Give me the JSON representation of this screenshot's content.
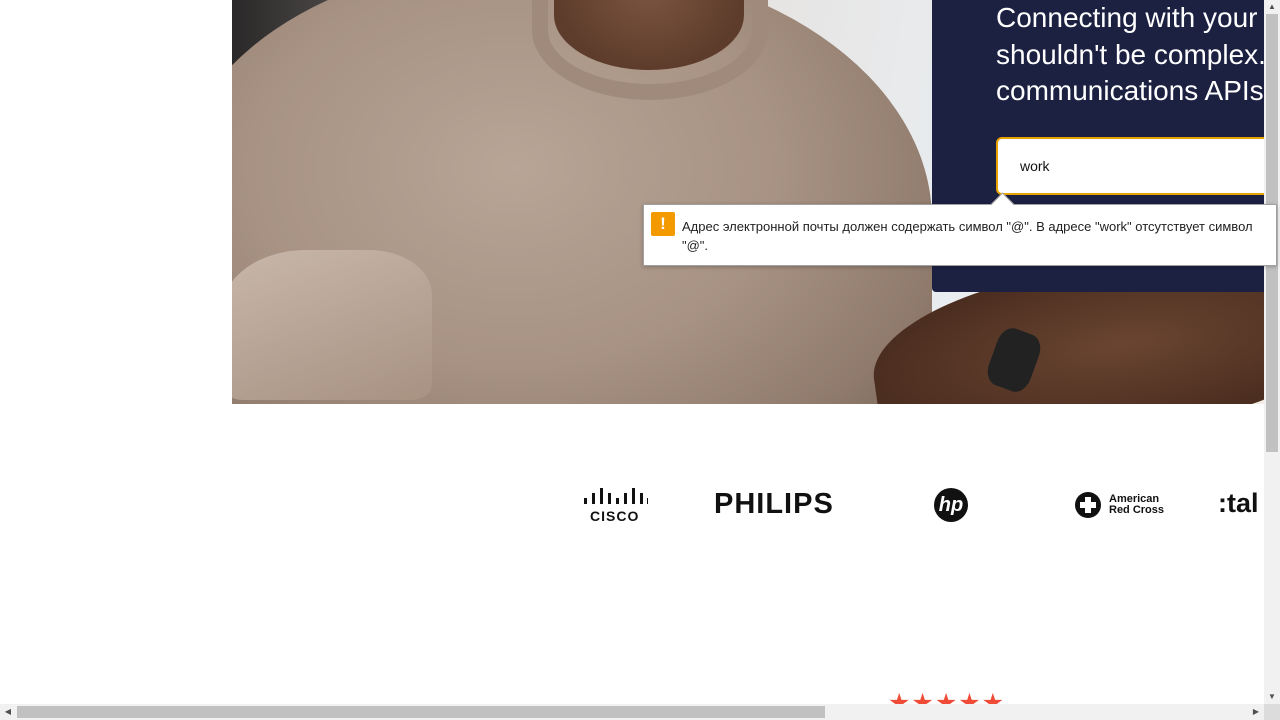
{
  "hero": {
    "heading_lines": [
      "Connecting with your",
      "shouldn't be complex.",
      "communications APIs"
    ],
    "email_value": "work"
  },
  "validation_tooltip": {
    "icon": "!",
    "message": "Адрес электронной почты должен содержать символ \"@\". В адресе \"work\" отсутствует символ \"@\"."
  },
  "logos": {
    "cisco": "CISCO",
    "philips": "PHILIPS",
    "hp": "hp",
    "redcross_line1": "American",
    "redcross_line2": "Red Cross",
    "talkdesk": ":tal"
  },
  "rating": {
    "stars": "★★★★★",
    "color": "#ef4b36"
  },
  "colors": {
    "panel": "#1c2142",
    "input_border": "#e8a300",
    "warning": "#f29a00"
  },
  "scrollbars": {
    "up": "▲",
    "down": "▼",
    "left": "◀",
    "right": "▶"
  }
}
